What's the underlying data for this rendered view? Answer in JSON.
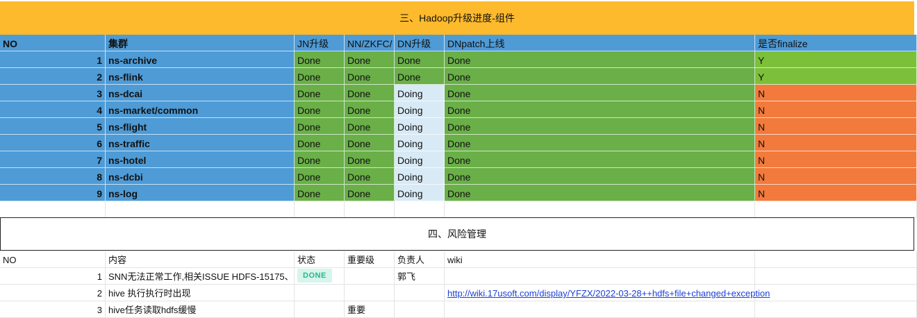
{
  "section1": {
    "title": "三、Hadoop升级进度-组件",
    "headers": [
      "NO",
      "集群",
      "JN升级",
      "NN/ZKFC/",
      "DN升级",
      "DNpatch上线",
      "是否finalize"
    ],
    "rows": [
      {
        "no": "1",
        "cluster": "ns-archive",
        "jn": "Done",
        "nn": "Done",
        "dn": "Done",
        "patch": "Done",
        "finalize": "Y"
      },
      {
        "no": "2",
        "cluster": "ns-flink",
        "jn": "Done",
        "nn": "Done",
        "dn": "Done",
        "patch": "Done",
        "finalize": "Y"
      },
      {
        "no": "3",
        "cluster": "ns-dcai",
        "jn": "Done",
        "nn": "Done",
        "dn": "Doing",
        "patch": "Done",
        "finalize": "N"
      },
      {
        "no": "4",
        "cluster": "ns-market/common",
        "jn": "Done",
        "nn": "Done",
        "dn": "Doing",
        "patch": "Done",
        "finalize": "N"
      },
      {
        "no": "5",
        "cluster": "ns-flight",
        "jn": "Done",
        "nn": "Done",
        "dn": "Doing",
        "patch": "Done",
        "finalize": "N"
      },
      {
        "no": "6",
        "cluster": "ns-traffic",
        "jn": "Done",
        "nn": "Done",
        "dn": "Doing",
        "patch": "Done",
        "finalize": "N"
      },
      {
        "no": "7",
        "cluster": "ns-hotel",
        "jn": "Done",
        "nn": "Done",
        "dn": "Doing",
        "patch": "Done",
        "finalize": "N"
      },
      {
        "no": "8",
        "cluster": "ns-dcbi",
        "jn": "Done",
        "nn": "Done",
        "dn": "Doing",
        "patch": "Done",
        "finalize": "N"
      },
      {
        "no": "9",
        "cluster": "ns-log",
        "jn": "Done",
        "nn": "Done",
        "dn": "Doing",
        "patch": "Done",
        "finalize": "N"
      }
    ]
  },
  "section2": {
    "title": "四、风险管理",
    "headers": [
      "NO",
      "内容",
      "状态",
      "重要级",
      "负责人",
      "wiki"
    ],
    "rows": [
      {
        "no": "1",
        "content": "SNN无法正常工作,相关ISSUE  HDFS-15175、",
        "status": "DONE",
        "priority": "",
        "owner": "郭飞",
        "wiki": ""
      },
      {
        "no": "2",
        "content": "hive 执行执行时出现",
        "status": "",
        "priority": "",
        "owner": "",
        "wiki": "http://wiki.17usoft.com/display/YFZX/2022-03-28++hdfs+file+changed+exception"
      },
      {
        "no": "3",
        "content": "hive任务读取hdfs缓慢",
        "status": "",
        "priority": "重要",
        "owner": "",
        "wiki": ""
      }
    ]
  },
  "colors": {
    "header_yellow": "#FDBA2C",
    "blue": "#4E9BD6",
    "green": "#6AAF48",
    "lime": "#7CC03A",
    "orange": "#F27A3C",
    "light_blue": "#D8EAF6",
    "badge_green": "#27B88A"
  }
}
